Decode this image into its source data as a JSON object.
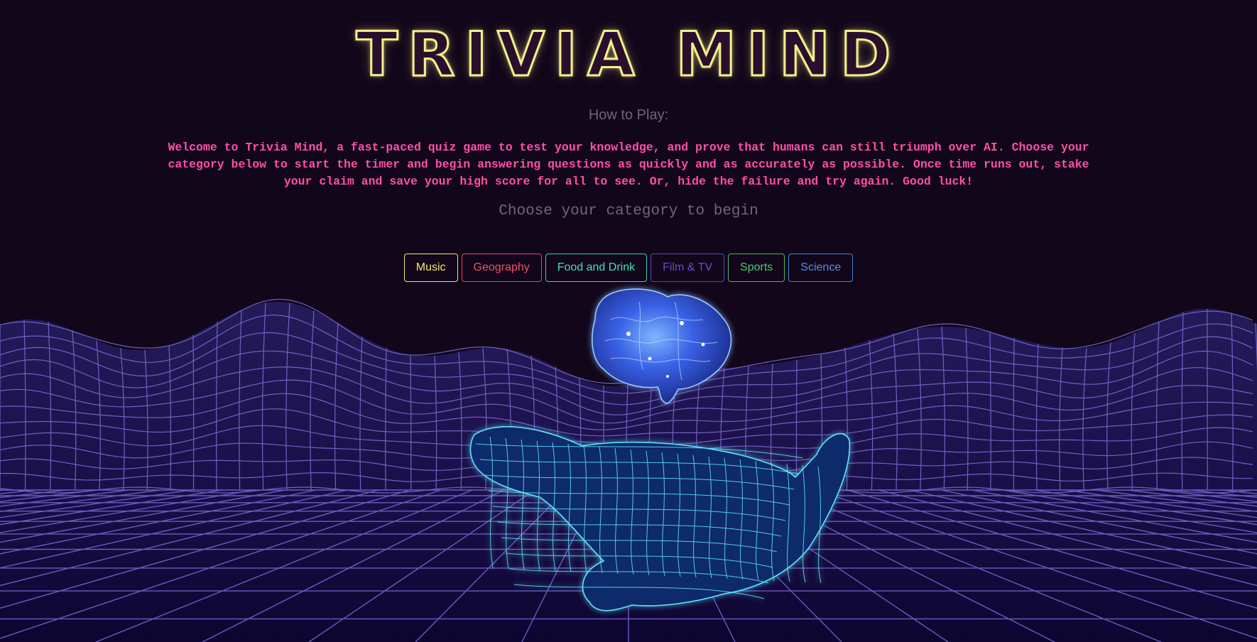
{
  "title": "TRIVIA MIND",
  "how_to_play_label": "How to Play:",
  "welcome_text": "Welcome to Trivia Mind, a fast-paced quiz game to test your knowledge, and prove that humans can still triumph over AI. Choose your category below to start the timer and begin answering questions as quickly and as accurately as possible. Once time runs out, stake your claim and save your high score for all to see. Or, hide the failure and try again. Good luck!",
  "choose_prompt": "Choose your category to begin",
  "categories": [
    {
      "label": "Music",
      "color": "#f4e86a"
    },
    {
      "label": "Geography",
      "color": "#f25068"
    },
    {
      "label": "Food and Drink",
      "color": "#43e0b8"
    },
    {
      "label": "Film & TV",
      "color": "#5b4fd8"
    },
    {
      "label": "Sports",
      "color": "#4ec96a"
    },
    {
      "label": "Science",
      "color": "#4f8fe6"
    }
  ],
  "colors": {
    "background": "#12061a",
    "title_glow": "#f3f08b",
    "welcome_text": "#ff4fa8",
    "muted_text": "#6d6874",
    "grid_line": "#7a6ad0",
    "hand_wireframe": "#5ee6ff",
    "brain_glow": "#3f7cff"
  },
  "illustration": {
    "brain": "brain-icon",
    "hand": "wireframe-hand",
    "terrain": "wireframe-terrain"
  }
}
